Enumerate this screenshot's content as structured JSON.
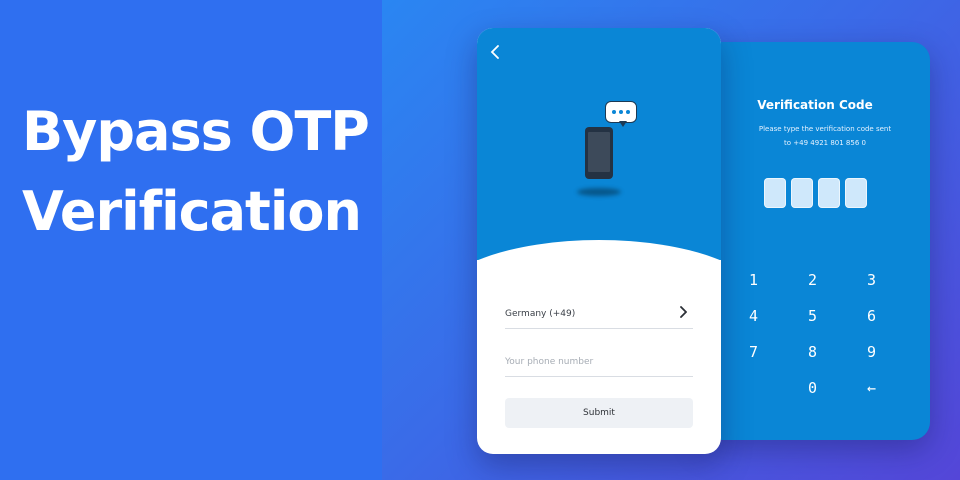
{
  "headline": {
    "line1": "Bypass OTP",
    "line2": "Verification"
  },
  "signup_screen": {
    "back_icon": "chevron-left-icon",
    "illustration": [
      "smartphone-icon",
      "chat-bubble-icon"
    ],
    "country": {
      "label": "Germany  (+49)",
      "chevron": ">"
    },
    "phone_input": {
      "value": "",
      "placeholder": "Your phone number"
    },
    "submit_label": "Submit"
  },
  "verification_screen": {
    "title": "Verification Code",
    "subtitle_line1": "Please type the verification code sent",
    "subtitle_line2": "to +49 4921 801 856 0",
    "code_digits": [
      "",
      "",
      "",
      ""
    ],
    "keypad": [
      "1",
      "2",
      "3",
      "4",
      "5",
      "6",
      "7",
      "8",
      "9",
      "",
      "0",
      "←"
    ]
  },
  "colors": {
    "left_bg": "#2f6ff0",
    "phone_blue": "#0a86d6",
    "otp_box": "#cfe8fb",
    "submit_bg": "#eef1f5",
    "gradient_start": "#2a86f2",
    "gradient_end": "#5446d8"
  }
}
